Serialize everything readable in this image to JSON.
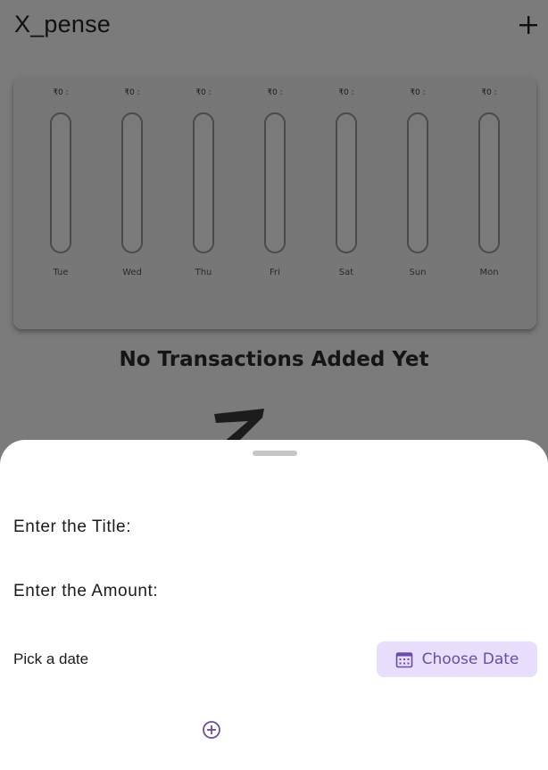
{
  "app": {
    "title": "X_pense",
    "add_icon": "plus-icon"
  },
  "chart": {
    "days": [
      {
        "day": "Tue",
        "amount": "₹0 :",
        "fraction": 0
      },
      {
        "day": "Wed",
        "amount": "₹0 :",
        "fraction": 0
      },
      {
        "day": "Thu",
        "amount": "₹0 :",
        "fraction": 0
      },
      {
        "day": "Fri",
        "amount": "₹0 :",
        "fraction": 0
      },
      {
        "day": "Sat",
        "amount": "₹0 :",
        "fraction": 0
      },
      {
        "day": "Sun",
        "amount": "₹0 :",
        "fraction": 0
      },
      {
        "day": "Mon",
        "amount": "₹0 :",
        "fraction": 0
      }
    ]
  },
  "empty_state": {
    "message": "No Transactions Added Yet"
  },
  "sheet": {
    "title_placeholder": "Enter the Title:",
    "amount_placeholder": "Enter the Amount:",
    "pick_date_label": "Pick a date",
    "choose_date_label": "Choose Date",
    "calendar_icon": "calendar-icon",
    "submit_icon": "add-circle-icon"
  },
  "colors": {
    "accent": "#6a4bb0",
    "accent_container": "#e9defc",
    "scrim_bg": "#7b7b7b"
  }
}
